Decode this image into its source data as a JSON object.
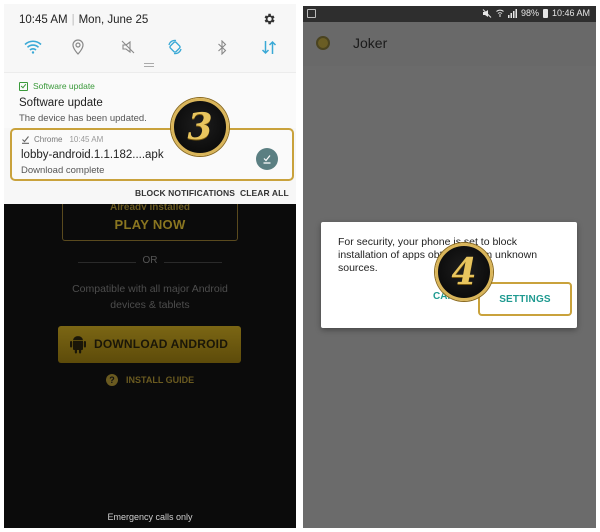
{
  "left_screen": {
    "quick_settings": {
      "time": "10:45 AM",
      "date": "Mon, June 25",
      "toggles": [
        {
          "name": "wifi",
          "active": true
        },
        {
          "name": "location",
          "active": false
        },
        {
          "name": "mute",
          "active": false
        },
        {
          "name": "auto-rotate",
          "active": true
        },
        {
          "name": "bluetooth",
          "active": false
        },
        {
          "name": "mobile-data",
          "active": true
        }
      ]
    },
    "notifications": [
      {
        "app": "Software update",
        "title": "Software update",
        "body": "The device has been updated."
      },
      {
        "app": "Chrome",
        "time": "10:45 AM",
        "title": "lobby-android.1.1.182....apk",
        "body": "Download complete"
      }
    ],
    "actions": {
      "block": "BLOCK NOTIFICATIONS",
      "clear": "CLEAR ALL"
    },
    "page": {
      "already_installed": "Already installed",
      "play_now": "PLAY NOW",
      "or": "OR",
      "compat_line1": "Compatible with all major Android",
      "compat_line2": "devices & tablets",
      "download": "DOWNLOAD ANDROID",
      "install_guide_icon": "?",
      "install_guide": "INSTALL GUIDE",
      "emergency": "Emergency calls only"
    },
    "step_badge": "3"
  },
  "right_screen": {
    "status_bar": {
      "battery": "98%",
      "time": "10:46 AM"
    },
    "app_title": "Joker",
    "dialog": {
      "message": "For security, your phone is set to block installation of apps obtained from unknown sources.",
      "cancel": "CANCEL",
      "settings": "SETTINGS"
    },
    "step_badge": "4"
  },
  "colors": {
    "accent_teal": "#1f9a90",
    "highlight_gold": "#c9a23c",
    "qs_active": "#3aa9d6",
    "update_green": "#3a9a3a"
  }
}
